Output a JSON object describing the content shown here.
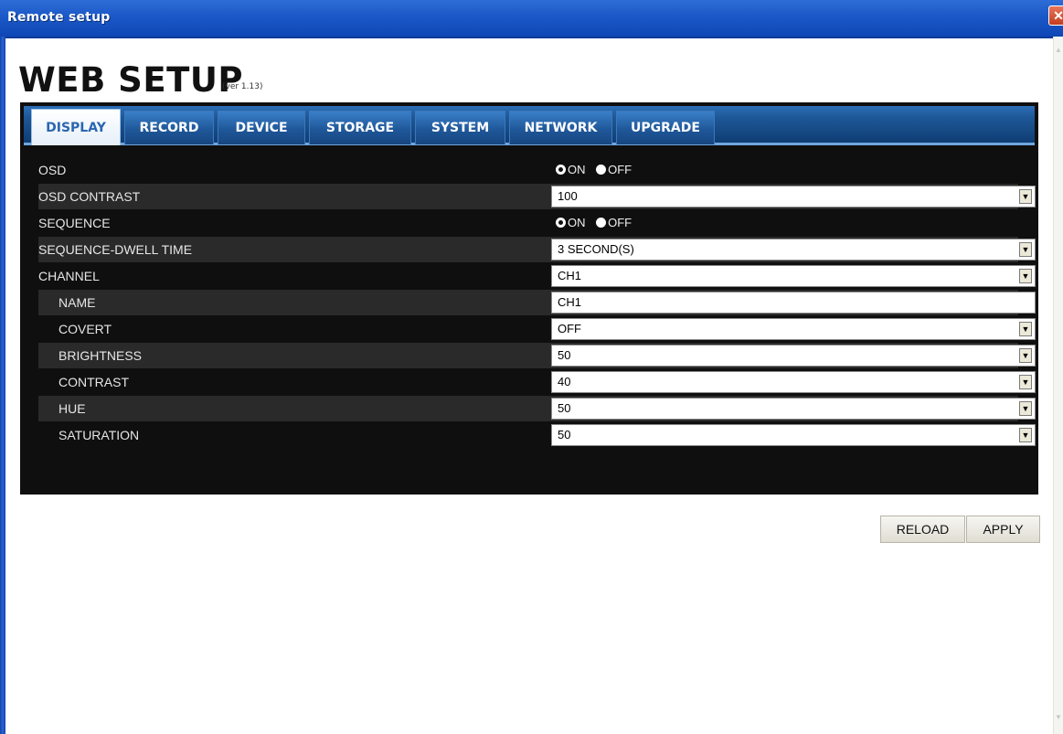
{
  "window": {
    "title": "Remote setup",
    "close_symbol": "✕"
  },
  "header": {
    "title": "WEB SETUP",
    "version": "(ver 1.13)"
  },
  "tabs": [
    {
      "label": "DISPLAY",
      "active": true
    },
    {
      "label": "RECORD",
      "active": false
    },
    {
      "label": "DEVICE",
      "active": false
    },
    {
      "label": "STORAGE",
      "active": false
    },
    {
      "label": "SYSTEM",
      "active": false
    },
    {
      "label": "NETWORK",
      "active": false
    },
    {
      "label": "UPGRADE",
      "active": false
    }
  ],
  "settings": {
    "osd": {
      "label": "OSD",
      "options": [
        "ON",
        "OFF"
      ],
      "selected": "ON"
    },
    "osd_contrast": {
      "label": "OSD CONTRAST",
      "value": "100"
    },
    "sequence": {
      "label": "SEQUENCE",
      "options": [
        "ON",
        "OFF"
      ],
      "selected": "ON"
    },
    "sequence_dwell": {
      "label": "SEQUENCE-DWELL TIME",
      "value": "3 SECOND(S)"
    },
    "channel": {
      "label": "CHANNEL",
      "value": "CH1"
    },
    "name": {
      "label": "NAME",
      "value": "CH1"
    },
    "covert": {
      "label": "COVERT",
      "value": "OFF"
    },
    "brightness": {
      "label": "BRIGHTNESS",
      "value": "50"
    },
    "contrast": {
      "label": "CONTRAST",
      "value": "40"
    },
    "hue": {
      "label": "HUE",
      "value": "50"
    },
    "saturation": {
      "label": "SATURATION",
      "value": "50"
    }
  },
  "buttons": {
    "reload": "RELOAD",
    "apply": "APPLY"
  },
  "colors": {
    "titlebar": "#1b58c8",
    "panel": "#0f0f0f",
    "tab": "#1f5799",
    "active_tab_text": "#2b66b0"
  }
}
